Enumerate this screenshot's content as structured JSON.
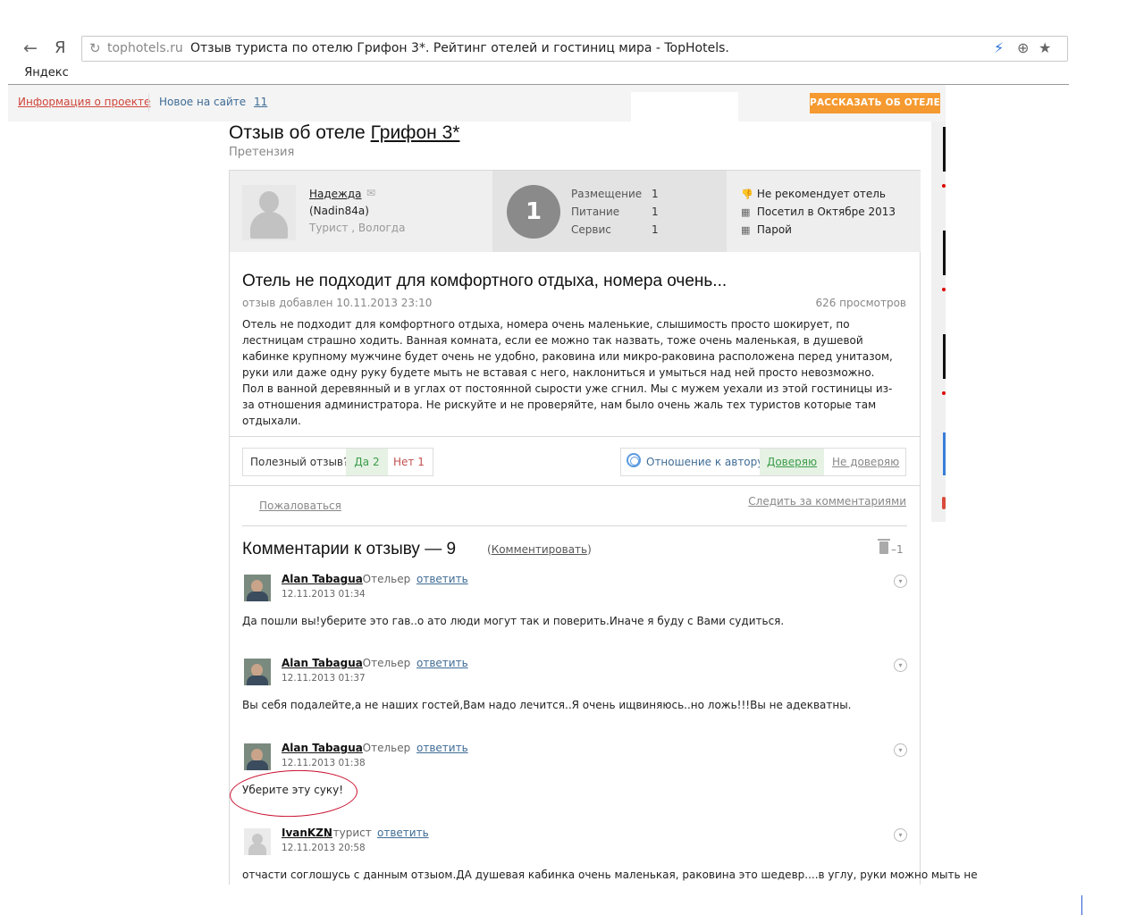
{
  "browser": {
    "back_glyph": "←",
    "ya_glyph": "Я",
    "reload_glyph": "↻",
    "address_domain": "tophotels.ru",
    "address_title": "Отзыв туриста по отелю Грифон 3*. Рейтинг отелей и гостиниц мира - TopHotels.",
    "zoom_glyph": "⊕",
    "star_glyph": "★",
    "sync_glyph": "⚡",
    "tab_label": "Яндекс"
  },
  "topbar": {
    "info_link": "Информация о проекте",
    "new_link": "Новое на сайте",
    "new_count": "11",
    "tell_button": "РАССКАЗАТЬ ОБ ОТЕЛЕ"
  },
  "page": {
    "title_prefix": "Отзыв об отеле",
    "hotel_name": "Грифон 3*",
    "subtitle": "Претензия"
  },
  "author": {
    "name": "Надежда",
    "login": "(Nadin84a)",
    "role": "Турист , Вологда",
    "mail_glyph": "✉"
  },
  "scores": {
    "overall": "1",
    "items": [
      {
        "label": "Размещение",
        "value": "1"
      },
      {
        "label": "Питание",
        "value": "1"
      },
      {
        "label": "Сервис",
        "value": "1"
      }
    ]
  },
  "meta": [
    {
      "icon": "thumbs-down-icon",
      "glyph": "👎",
      "text": "Не рекомендует отель"
    },
    {
      "icon": "calendar-icon",
      "glyph": "▦",
      "text": "Посетил в Октябре 2013"
    },
    {
      "icon": "calendar-icon",
      "glyph": "▦",
      "text": "Парой"
    }
  ],
  "review": {
    "headline": "Отель не подходит для комфортного отдыха, номера очень...",
    "added": "отзыв добавлен 10.11.2013 23:10",
    "views": "626 просмотров",
    "text": "Отель не подходит для комфортного отдыха, номера очень маленькие, слышимость просто шокирует, по лестницам страшно ходить. Ванная комната, если ее можно так назвать, тоже очень маленькая, в душевой кабинке крупному мужчине будет очень не удобно, раковина или микро-раковина расположена перед унитазом, руки или даже одну руку будете мыть не вставая с него, наклониться и умыться над ней просто невозможно. Пол в ванной деревянный и в углах от постоянной сырости уже сгнил. Мы с мужем уехали из этой гостиницы из-за отношения администратора. Не рискуйте и не проверяйте, нам было очень жаль тех туристов которые там отдыхали."
  },
  "feedback": {
    "useful_question": "Полезный отзыв?",
    "yes": "Да 2",
    "no": "Нет 1",
    "trust_label": "Отношение к автору",
    "trust_yes": "Доверяю",
    "trust_no": "Не доверяю",
    "complain": "Пожаловаться",
    "follow": "Следить за комментариями"
  },
  "comments": {
    "title": "Комментарии к отзыву — 9",
    "action_open": "(",
    "action": "Комментировать",
    "action_close": ")",
    "deleted": "–1",
    "menu_glyph": "▾",
    "items": [
      {
        "author": "Alan Tabagua",
        "role": ", Отельер",
        "reply": "ответить",
        "date": "12.11.2013 01:34",
        "text": "Да пошли вы!уберите это гав..о ато люди могут так и поверить.Иначе я буду с Вами судиться."
      },
      {
        "author": "Alan Tabagua",
        "role": ", Отельер",
        "reply": "ответить",
        "date": "12.11.2013 01:37",
        "text": "Вы себя подалейте,а не наших гостей,Вам надо лечится..Я очень ищвиняюсь..но ложь!!!Вы не адекватны."
      },
      {
        "author": "Alan Tabagua",
        "role": ", Отельер",
        "reply": "ответить",
        "date": "12.11.2013 01:38",
        "text": "Уберите эту суку!"
      },
      {
        "author": "IvanKZN",
        "role": ", турист",
        "reply": "ответить",
        "date": "12.11.2013 20:58",
        "text": "отчасти соглошусь с данным отзыом.ДА душевая кабинка очень маленькая, раковина это шедевр....в углу, руки можно мыть не"
      }
    ]
  },
  "colors": {
    "accent_orange": "#f59a30",
    "link_blue": "#3f6c95",
    "green_bg": "#e6f2e4",
    "annotation_red": "#c8102e"
  }
}
